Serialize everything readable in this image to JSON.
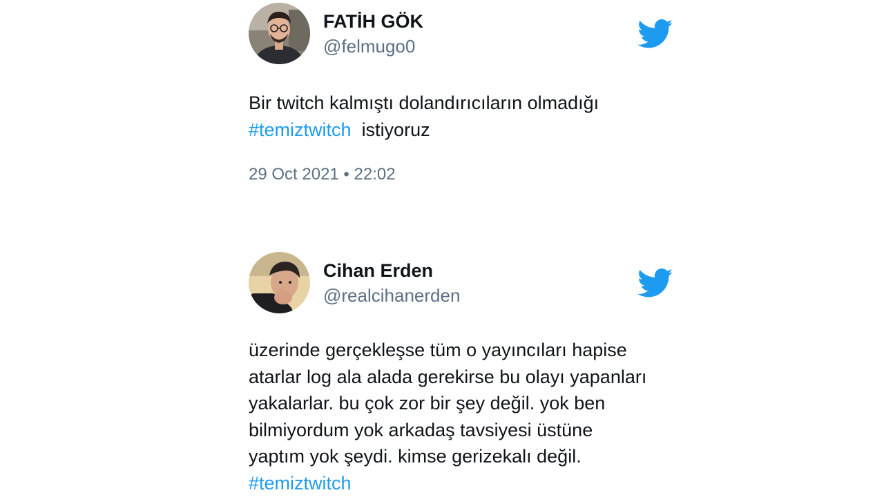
{
  "tweets": [
    {
      "name": "FATİH GÖK",
      "handle": "@felmugo0",
      "text_before": "Bir twitch kalmıştı dolandırıcıların olmadığı",
      "hashtag": "#temiztwitch",
      "text_after": "istiyoruz",
      "timestamp": "29 Oct 2021 • 22:02",
      "logo_icon": "twitter-bird-icon"
    },
    {
      "name": "Cihan Erden",
      "handle": "@realcihanerden",
      "lines": [
        "üzerinde gerçekleşse tüm o yayıncıları hapise",
        "atarlar log ala alada gerekirse bu olayı yapanları",
        "yakalarlar. bu çok zor bir şey değil. yok ben",
        "bilmiyordum yok arkadaş tavsiyesi üstüne",
        "yaptım yok şeydi. kimse gerizekalı değil."
      ],
      "hashtag": "#temiztwitch",
      "logo_icon": "twitter-bird-icon"
    }
  ],
  "colors": {
    "text": "#0f1419",
    "secondary": "#5b7083",
    "accent": "#1d9bf0"
  }
}
